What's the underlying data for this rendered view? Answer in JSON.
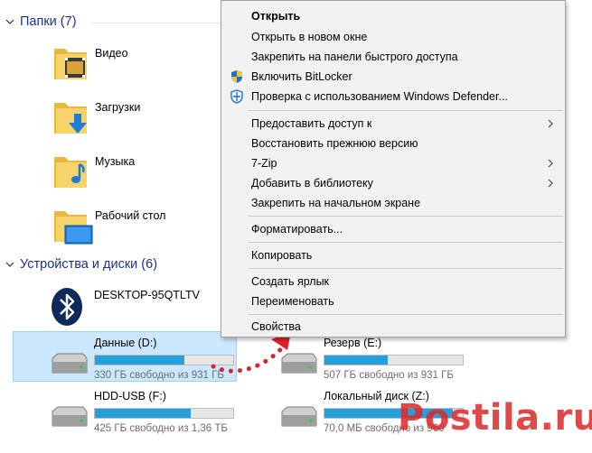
{
  "sections": {
    "folders_title": "Папки (7)",
    "devices_title": "Устройства и диски (6)"
  },
  "folders": [
    {
      "label": "Видео",
      "icon": "video-folder-icon"
    },
    {
      "label": "Загрузки",
      "icon": "downloads-folder-icon"
    },
    {
      "label": "Музыка",
      "icon": "music-folder-icon"
    },
    {
      "label": "Рабочий стол",
      "icon": "desktop-folder-icon"
    }
  ],
  "devices": {
    "bluetooth": {
      "label": "DESKTOP-95QTLTV",
      "icon": "bluetooth-icon"
    },
    "data_d": {
      "label": "Данные (D:)",
      "sub": "330 ГБ свободно из 931 ГБ",
      "used": 0.65
    },
    "reserve_e": {
      "label": "Резерв (E:)",
      "sub": "507 ГБ свободно из 931 ГБ",
      "used": 0.46
    },
    "hdd_usb_f": {
      "label": "HDD-USB (F:)",
      "sub": "425 ГБ свободно из 1,36 ТБ",
      "used": 0.69
    },
    "local_z": {
      "label": "Локальный диск (Z:)",
      "sub": "70,0 МБ свободно из 960",
      "used": 0.93
    }
  },
  "context_menu": {
    "open": "Открыть",
    "open_new_window": "Открыть в новом окне",
    "pin_quick_access": "Закрепить на панели быстрого доступа",
    "bitlocker": "Включить BitLocker",
    "defender": "Проверка с использованием Windows Defender...",
    "give_access": "Предоставить доступ к",
    "restore_previous": "Восстановить прежнюю версию",
    "sevenzip": "7-Zip",
    "add_to_library": "Добавить в библиотеку",
    "pin_start": "Закрепить на начальном экране",
    "format": "Форматировать...",
    "copy": "Копировать",
    "create_shortcut": "Создать ярлык",
    "rename": "Переименовать",
    "properties": "Свойства"
  },
  "watermark": "Postila.ru",
  "colors": {
    "accent": "#26a0da",
    "selection": "#cce8ff",
    "header": "#1e3287",
    "annotation": "#e0202a"
  }
}
